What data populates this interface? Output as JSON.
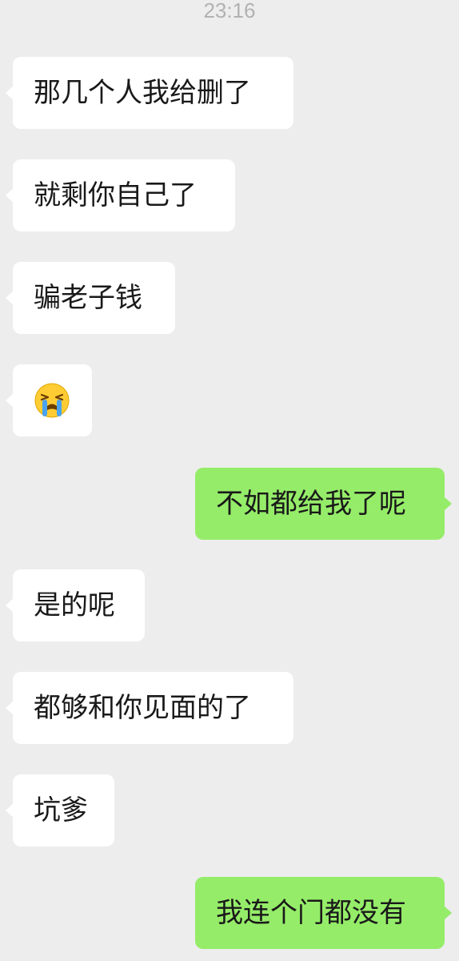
{
  "chat": {
    "timestamp": "23:16",
    "messages": [
      {
        "side": "in",
        "text": "那几个人我给删了"
      },
      {
        "side": "in",
        "text": "就剩你自己了"
      },
      {
        "side": "in",
        "text": "骗老子钱"
      },
      {
        "side": "in",
        "emoji": "crying-face-icon"
      },
      {
        "side": "out",
        "text": "不如都给我了呢"
      },
      {
        "side": "in",
        "text": "是的呢"
      },
      {
        "side": "in",
        "text": "都够和你见面的了"
      },
      {
        "side": "in",
        "text": "坑爹"
      },
      {
        "side": "out",
        "text": "我连个门都没有"
      }
    ]
  },
  "colors": {
    "background": "#ededed",
    "incoming_bubble": "#ffffff",
    "outgoing_bubble": "#95ec69",
    "timestamp_text": "#b2b2b2"
  }
}
